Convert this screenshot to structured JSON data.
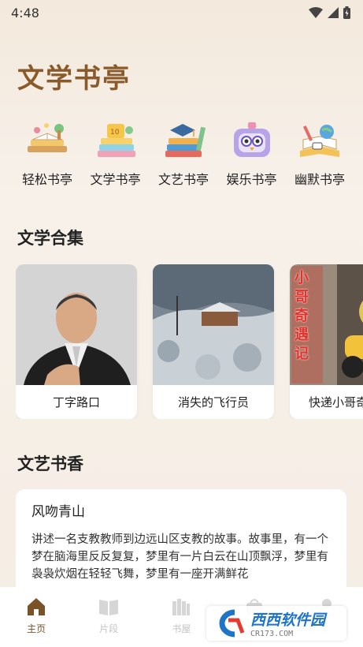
{
  "status": {
    "time": "4:48"
  },
  "header": {
    "title": "文学书亭"
  },
  "categories": [
    {
      "label": "轻松书亭",
      "icon": "books-plant-icon"
    },
    {
      "label": "文学书亭",
      "icon": "notebook-stack-icon"
    },
    {
      "label": "文艺书亭",
      "icon": "graduation-books-icon"
    },
    {
      "label": "娱乐书亭",
      "icon": "robot-toy-icon"
    },
    {
      "label": "幽默书亭",
      "icon": "open-book-globe-icon"
    }
  ],
  "collection": {
    "title": "文学合集",
    "items": [
      {
        "label": "丁字路口"
      },
      {
        "label": "消失的飞行员"
      },
      {
        "label": "快递小哥奇遇记",
        "cover_text": "小哥奇遇记"
      }
    ]
  },
  "featured": {
    "title": "文艺书香",
    "article": {
      "title": "风吻青山",
      "body": "讲述一名支教教师到边远山区支教的故事。故事里，有一个梦在脑海里反反复复，梦里有一片白云在山顶飘浮，梦里有袅袅炊烟在轻轻飞舞，梦里有一座开满鲜花"
    }
  },
  "tabs": [
    {
      "label": "主页",
      "icon": "home-icon",
      "active": true
    },
    {
      "label": "片段",
      "icon": "book-open-icon",
      "active": false
    },
    {
      "label": "书屋",
      "icon": "bookshelf-icon",
      "active": false
    },
    {
      "label": "",
      "icon": "bag-icon",
      "active": false
    },
    {
      "label": "",
      "icon": "profile-icon",
      "active": false
    }
  ],
  "watermark": {
    "brand": "西西软件园",
    "url": "CR173.COM"
  },
  "colors": {
    "accent": "#8a5a2b",
    "tab_active": "#7a5226",
    "tab_inactive": "#c4c4c4"
  }
}
